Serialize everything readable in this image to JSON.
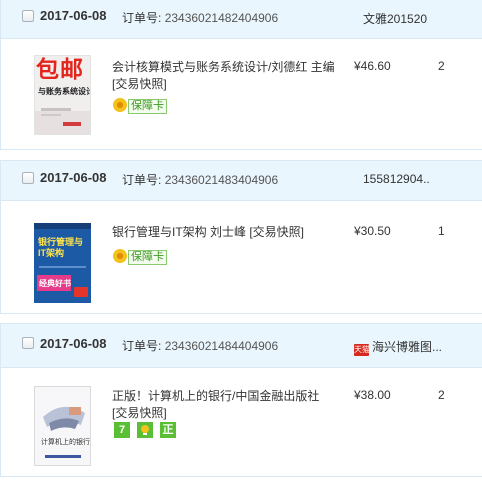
{
  "orders": [
    {
      "date": "2017-06-08",
      "order_label": "订单号:",
      "order_number": "23436021482404906",
      "seller": "文雅201520",
      "item": {
        "title": "会计核算模式与账务系统设计/刘德红 主编 [交易快照]",
        "cover_text": "包邮",
        "cover_subtext": "与账务系统设计",
        "price": "¥46.60",
        "quantity": "2",
        "badge": "保障卡"
      }
    },
    {
      "date": "2017-06-08",
      "order_label": "订单号:",
      "order_number": "23436021483404906",
      "seller": "155812904..",
      "item": {
        "title": "银行管理与IT架构 刘士峰 [交易快照]",
        "cover_text": "银行管理与IT架构",
        "cover_subtext": "经典好书",
        "price": "¥30.50",
        "quantity": "1",
        "badge": "保障卡"
      }
    },
    {
      "date": "2017-06-08",
      "order_label": "订单号:",
      "order_number": "23436021484404906",
      "seller": "海兴博雅图...",
      "shop_icon": "天猫",
      "item": {
        "title": "正版！计算机上的银行/中国金融出版社 [交易快照]",
        "cover_text": "计算机上的银行",
        "price": "¥38.00",
        "quantity": "2",
        "service_icons": [
          "7",
          "",
          "正"
        ]
      }
    }
  ]
}
